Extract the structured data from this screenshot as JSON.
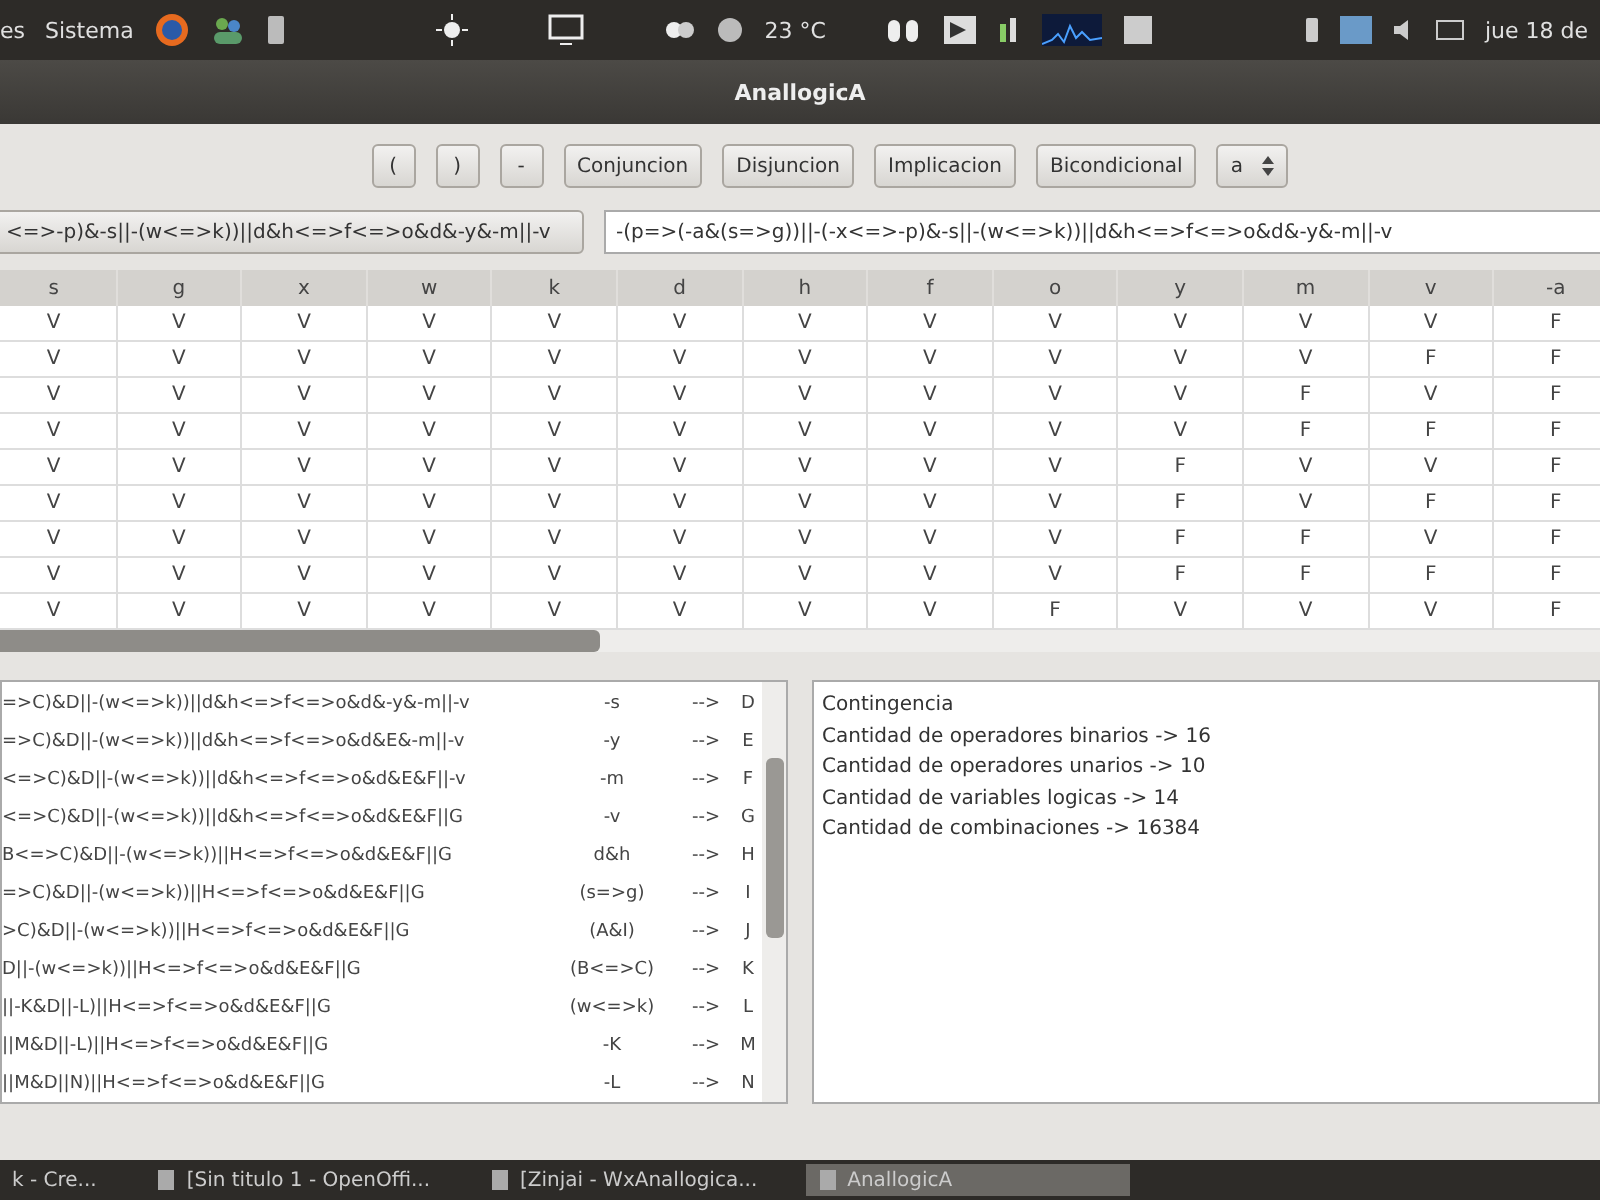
{
  "top_panel": {
    "menus": [
      "es",
      "Sistema"
    ],
    "weather": "23 °C",
    "clock": "jue 18 de"
  },
  "window": {
    "title": "AnallogicA"
  },
  "toolbar": {
    "buttons": [
      "(",
      ")",
      "-",
      "Conjuncion",
      "Disjuncion",
      "Implicacion",
      "Bicondicional"
    ],
    "variable_select": "a"
  },
  "formula_select": "<=>-p)&-s||-(w<=>k))||d&h<=>f<=>o&d&-y&-m||-v",
  "formula_input": "-(p=>(-a&(s=>g))||-(-x<=>-p)&-s||-(w<=>k))||d&h<=>f<=>o&d&-y&-m||-v",
  "table": {
    "columns": [
      "s",
      "g",
      "x",
      "w",
      "k",
      "d",
      "h",
      "f",
      "o",
      "y",
      "m",
      "v",
      "-a"
    ],
    "rows": [
      [
        "V",
        "V",
        "V",
        "V",
        "V",
        "V",
        "V",
        "V",
        "V",
        "V",
        "V",
        "V",
        "F"
      ],
      [
        "V",
        "V",
        "V",
        "V",
        "V",
        "V",
        "V",
        "V",
        "V",
        "V",
        "V",
        "F",
        "F"
      ],
      [
        "V",
        "V",
        "V",
        "V",
        "V",
        "V",
        "V",
        "V",
        "V",
        "V",
        "F",
        "V",
        "F"
      ],
      [
        "V",
        "V",
        "V",
        "V",
        "V",
        "V",
        "V",
        "V",
        "V",
        "V",
        "F",
        "F",
        "F"
      ],
      [
        "V",
        "V",
        "V",
        "V",
        "V",
        "V",
        "V",
        "V",
        "V",
        "F",
        "V",
        "V",
        "F"
      ],
      [
        "V",
        "V",
        "V",
        "V",
        "V",
        "V",
        "V",
        "V",
        "V",
        "F",
        "V",
        "F",
        "F"
      ],
      [
        "V",
        "V",
        "V",
        "V",
        "V",
        "V",
        "V",
        "V",
        "V",
        "F",
        "F",
        "V",
        "F"
      ],
      [
        "V",
        "V",
        "V",
        "V",
        "V",
        "V",
        "V",
        "V",
        "V",
        "F",
        "F",
        "F",
        "F"
      ],
      [
        "V",
        "V",
        "V",
        "V",
        "V",
        "V",
        "V",
        "V",
        "F",
        "V",
        "V",
        "V",
        "F"
      ]
    ]
  },
  "steps": [
    {
      "formula": "=>C)&D||-(w<=>k))||d&h<=>f<=>o&d&-y&-m||-v",
      "sub": "-s",
      "arrow": "-->",
      "letter": "D"
    },
    {
      "formula": "=>C)&D||-(w<=>k))||d&h<=>f<=>o&d&E&-m||-v",
      "sub": "-y",
      "arrow": "-->",
      "letter": "E"
    },
    {
      "formula": "<=>C)&D||-(w<=>k))||d&h<=>f<=>o&d&E&F||-v",
      "sub": "-m",
      "arrow": "-->",
      "letter": "F"
    },
    {
      "formula": "<=>C)&D||-(w<=>k))||d&h<=>f<=>o&d&E&F||G",
      "sub": "-v",
      "arrow": "-->",
      "letter": "G"
    },
    {
      "formula": "B<=>C)&D||-(w<=>k))||H<=>f<=>o&d&E&F||G",
      "sub": "d&h",
      "arrow": "-->",
      "letter": "H"
    },
    {
      "formula": "=>C)&D||-(w<=>k))||H<=>f<=>o&d&E&F||G",
      "sub": "(s=>g)",
      "arrow": "-->",
      "letter": "I"
    },
    {
      "formula": ">C)&D||-(w<=>k))||H<=>f<=>o&d&E&F||G",
      "sub": "(A&I)",
      "arrow": "-->",
      "letter": "J"
    },
    {
      "formula": "D||-(w<=>k))||H<=>f<=>o&d&E&F||G",
      "sub": "(B<=>C)",
      "arrow": "-->",
      "letter": "K"
    },
    {
      "formula": "||-K&D||-L)||H<=>f<=>o&d&E&F||G",
      "sub": "(w<=>k)",
      "arrow": "-->",
      "letter": "L"
    },
    {
      "formula": "||M&D||-L)||H<=>f<=>o&d&E&F||G",
      "sub": "-K",
      "arrow": "-->",
      "letter": "M"
    },
    {
      "formula": "||M&D||N)||H<=>f<=>o&d&E&F||G",
      "sub": "-L",
      "arrow": "-->",
      "letter": "N"
    }
  ],
  "results": [
    "Contingencia",
    "Cantidad de operadores binarios -> 16",
    "Cantidad de operadores unarios -> 10",
    "Cantidad de variables logicas -> 14",
    "Cantidad de combinaciones -> 16384"
  ],
  "taskbar": [
    {
      "label": "k - Cre...",
      "selected": false
    },
    {
      "label": "[Sin titulo 1 - OpenOffi...",
      "selected": false
    },
    {
      "label": "[Zinjai - WxAnallogica...",
      "selected": false
    },
    {
      "label": "AnallogicA",
      "selected": true
    }
  ]
}
